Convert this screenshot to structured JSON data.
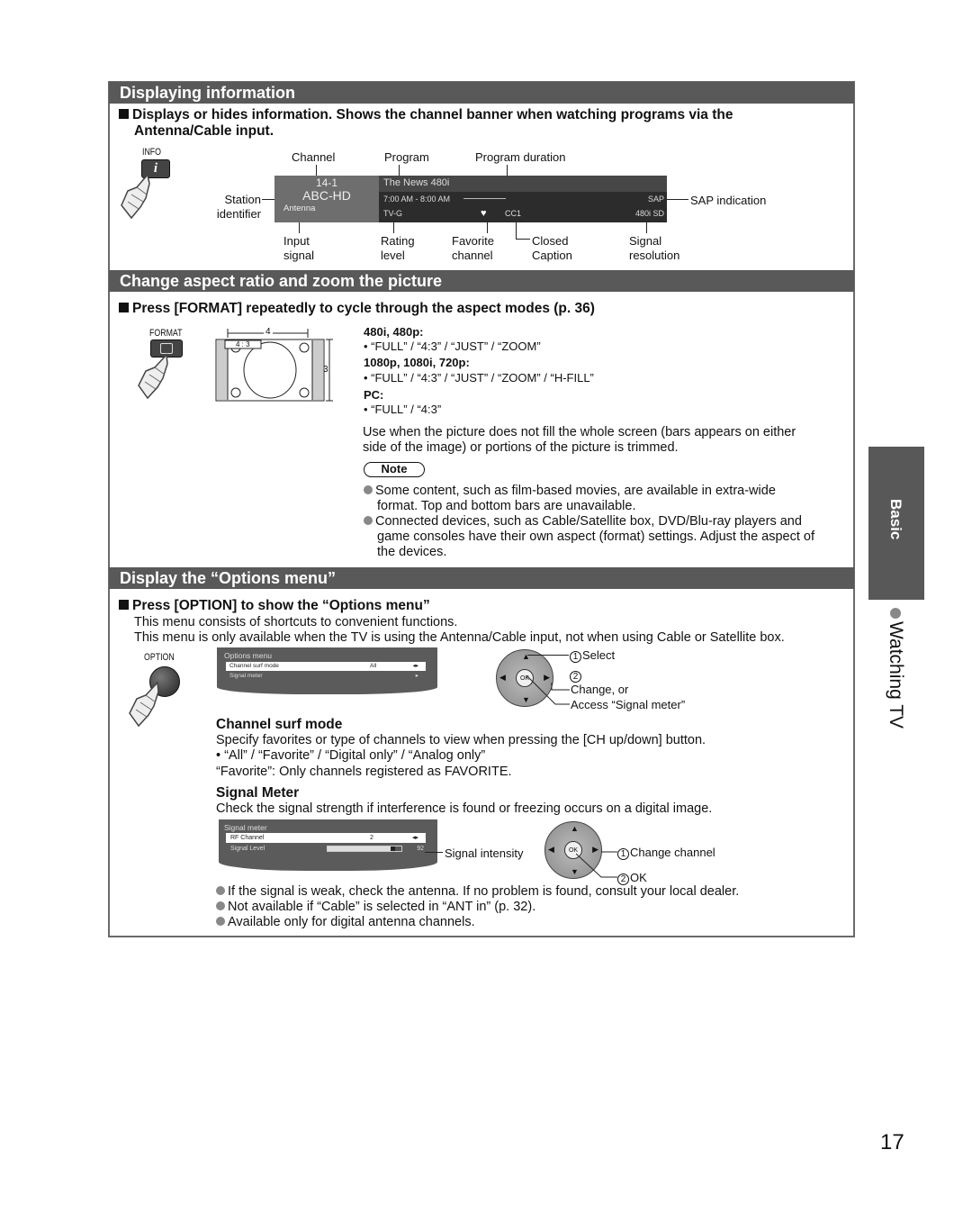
{
  "sections": {
    "info": {
      "title": "Displaying information",
      "lead_line1": "Displays or hides information. Shows the channel banner when watching programs via the",
      "lead_line2": "Antenna/Cable input.",
      "button_label": "INFO",
      "button_icon": "info-i-icon",
      "callouts": {
        "channel": "Channel",
        "program": "Program",
        "program_duration": "Program duration",
        "station_identifier_1": "Station",
        "station_identifier_2": "identifier",
        "sap_indication": "SAP indication",
        "input_signal_1": "Input",
        "input_signal_2": "signal",
        "rating_level_1": "Rating",
        "rating_level_2": "level",
        "favorite_channel_1": "Favorite",
        "favorite_channel_2": "channel",
        "closed_caption_1": "Closed",
        "closed_caption_2": "Caption",
        "signal_resolution_1": "Signal",
        "signal_resolution_2": "resolution"
      },
      "banner": {
        "channel_number": "14-1",
        "station": "ABC-HD",
        "input": "Antenna",
        "program": "The News 480i",
        "time": "7:00 AM - 8:00 AM",
        "sap": "SAP",
        "rating": "TV-G",
        "favorite_icon": "heart-icon",
        "cc": "CC1",
        "resolution": "480i SD"
      }
    },
    "aspect": {
      "title": "Change aspect ratio and zoom the picture",
      "lead": "Press [FORMAT] repeatedly to cycle through the aspect modes (p. 36)",
      "button_label": "FORMAT",
      "diagram": {
        "width_label": "4",
        "height_label": "3",
        "ratio_label": "4 : 3"
      },
      "modes": [
        {
          "heading": "480i, 480p:",
          "values": "• “FULL” / “4:3” / “JUST” / “ZOOM”"
        },
        {
          "heading": "1080p, 1080i, 720p:",
          "values": "• “FULL” / “4:3” / “JUST” / “ZOOM” / “H-FILL”"
        },
        {
          "heading": "PC:",
          "values": "• “FULL” / “4:3”"
        }
      ],
      "usage_1": "Use when the picture does not fill the whole screen (bars appears on either",
      "usage_2": "side of the image) or portions of the picture is trimmed.",
      "note_label": "Note",
      "notes": [
        {
          "l1": "Some content, such as film-based movies, are available in extra-wide",
          "l2": "format. Top and bottom bars are unavailable.",
          "l3": ""
        },
        {
          "l1": "Connected devices, such as Cable/Satellite box, DVD/Blu-ray players and",
          "l2": "game consoles have their own aspect (format) settings. Adjust the aspect of",
          "l3": "the devices."
        }
      ]
    },
    "options": {
      "title": "Display the “Options menu”",
      "lead": "Press [OPTION] to show the “Options menu”",
      "desc_1": "This menu consists of shortcuts to convenient functions.",
      "desc_2": "This menu is only available when the TV is using the Antenna/Cable input, not when using Cable or Satellite box.",
      "button_label": "OPTION",
      "menu": {
        "title": "Options menu",
        "rows": [
          {
            "label": "Channel surf mode",
            "value": "All"
          },
          {
            "label": "Signal meter",
            "value": ""
          }
        ]
      },
      "nav": {
        "step1": "Select",
        "step2_a": "Change, or",
        "step2_b": "Access “Signal meter”",
        "ok": "OK",
        "n1": "1",
        "n2": "2"
      },
      "surf": {
        "heading": "Channel surf mode",
        "l1": "Specify favorites or type of channels to view when pressing the [CH up/down] button.",
        "l2": "• “All” / “Favorite” / “Digital only” / “Analog only”",
        "l3": "“Favorite”: Only channels registered as FAVORITE."
      },
      "meter": {
        "heading": "Signal Meter",
        "l1": "Check the signal strength if interference is found or freezing occurs on a digital image.",
        "screen_title": "Signal meter",
        "rf_label": "RF Channel",
        "rf_value": "2",
        "level_label": "Signal Level",
        "level_value": "92",
        "level_fraction": 0.92,
        "intensity_label": "Signal intensity",
        "change_channel": "Change channel",
        "ok": "OK",
        "n1": "1",
        "n2": "2"
      },
      "bullets": [
        "If the signal is weak, check the antenna. If no problem is found, consult your local dealer.",
        "Not available if “Cable” is selected in “ANT in” (p. 32).",
        "Available only for digital antenna channels."
      ]
    }
  },
  "side": {
    "tab": "Basic",
    "chapter": "Watching TV"
  },
  "page_number": "17"
}
